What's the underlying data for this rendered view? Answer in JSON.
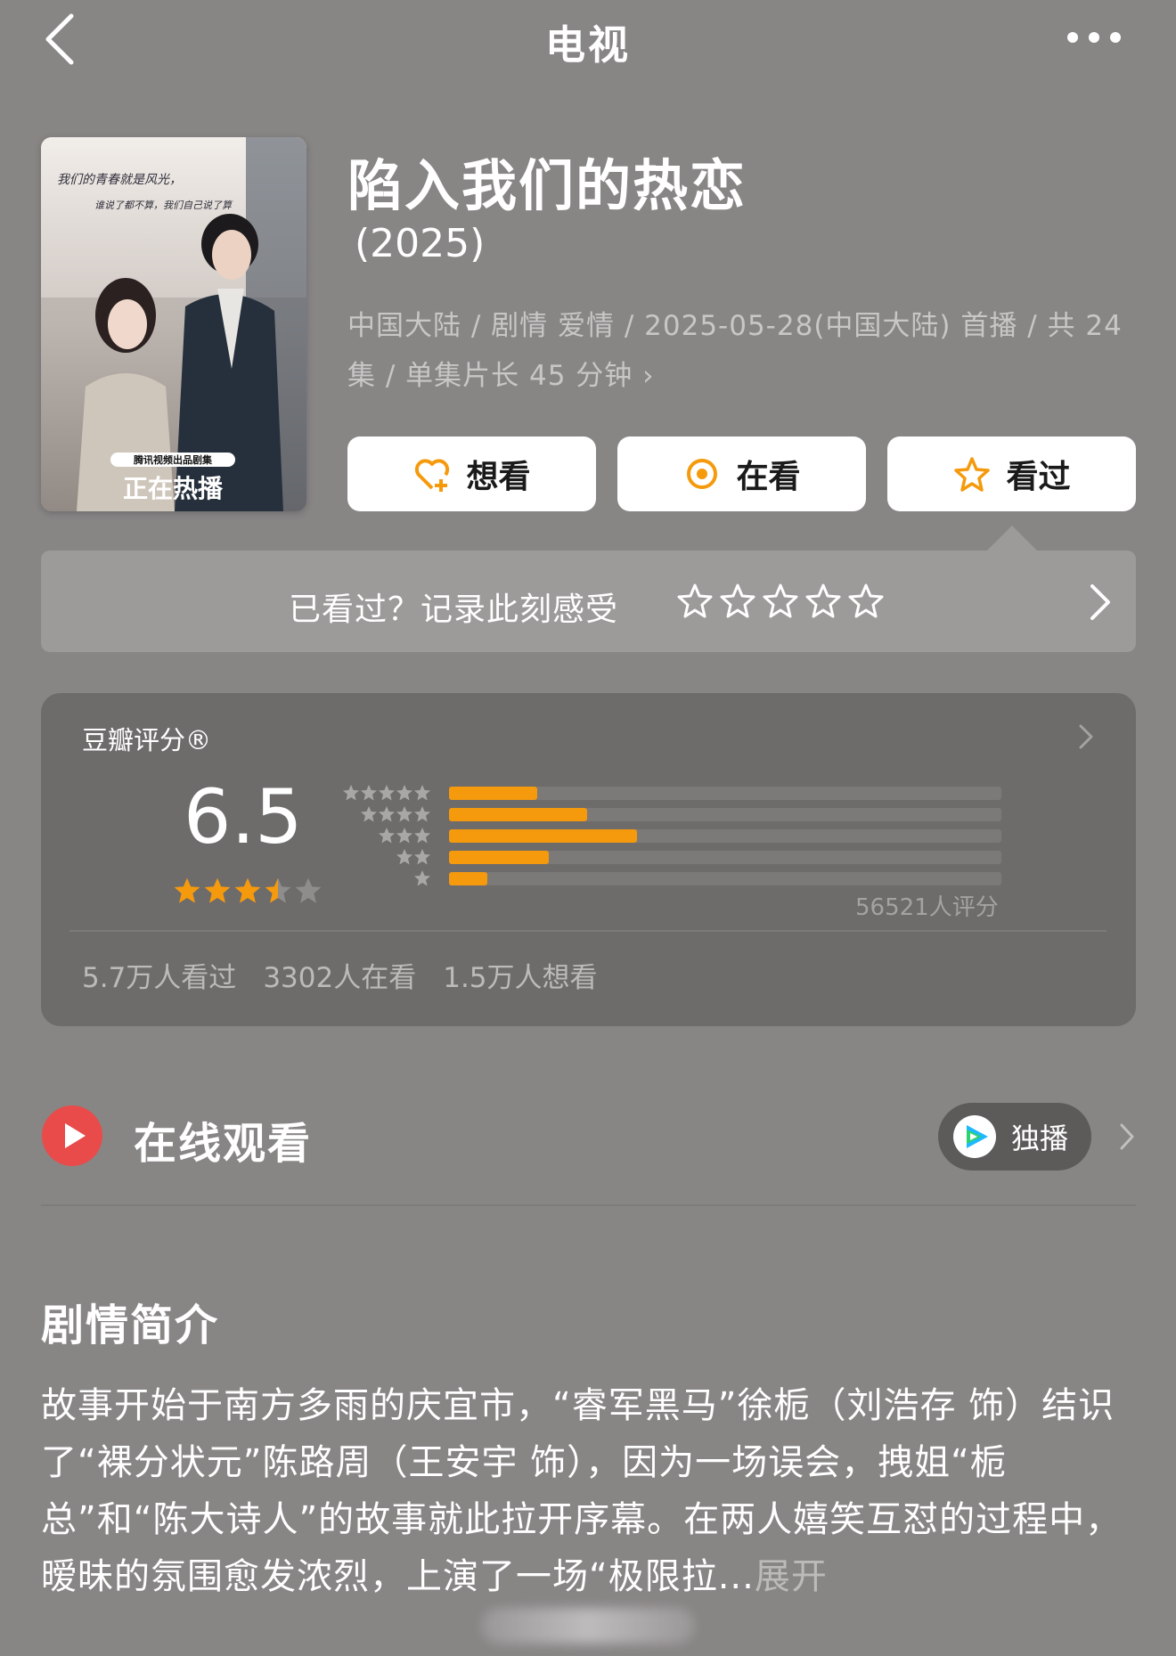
{
  "header": {
    "title": "电视",
    "back_icon": "chevron-left-icon",
    "more_icon": "ellipsis-icon"
  },
  "poster": {
    "handwriting_line1": "我们的青春就是风光，",
    "handwriting_line2": "谁说了都不算，我们自己说了算",
    "badge": "腾讯视频出品剧集",
    "banner": "正在热播"
  },
  "show": {
    "title": "陷入我们的热恋",
    "year": "(2025)",
    "meta": "中国大陆 / 剧情 爱情 / 2025-05-28(中国大陆) 首播 / 共 24 集 / 单集片长 45 分钟"
  },
  "actions": {
    "want": "想看",
    "watching": "在看",
    "watched": "看过"
  },
  "rate_prompt": {
    "text": "已看过？记录此刻感受"
  },
  "rating": {
    "label": "豆瓣评分®",
    "score": "6.5",
    "score_value": 6.5,
    "star_rating": 3.5,
    "distribution": [
      {
        "stars": 5,
        "fraction": 0.16
      },
      {
        "stars": 4,
        "fraction": 0.25
      },
      {
        "stars": 3,
        "fraction": 0.34
      },
      {
        "stars": 2,
        "fraction": 0.18
      },
      {
        "stars": 1,
        "fraction": 0.07
      }
    ],
    "count": "56521人评分",
    "stats": [
      "5.7万人看过",
      "3302人在看",
      "1.5万人想看"
    ]
  },
  "watch": {
    "label": "在线观看",
    "exclusive": "独播",
    "play_icon": "play-icon",
    "platform_icon": "tencent-video-icon"
  },
  "synopsis": {
    "title": "剧情简介",
    "text": "故事开始于南方多雨的庆宜市，“睿军黑马”徐栀（刘浩存 饰）结识了“裸分状元”陈路周（王安宇 饰），因为一场误会，拽姐“栀总”和“陈大诗人”的故事就此拉开序幕。在两人嬉笑互怼的过程中，暧昧的氛围愈发浓烈，上演了一场“极限拉...",
    "expand": "展开"
  },
  "colors": {
    "accent": "#f59a0c",
    "background": "#888585",
    "card": "#6e6b6b",
    "play": "#e94b4b"
  }
}
